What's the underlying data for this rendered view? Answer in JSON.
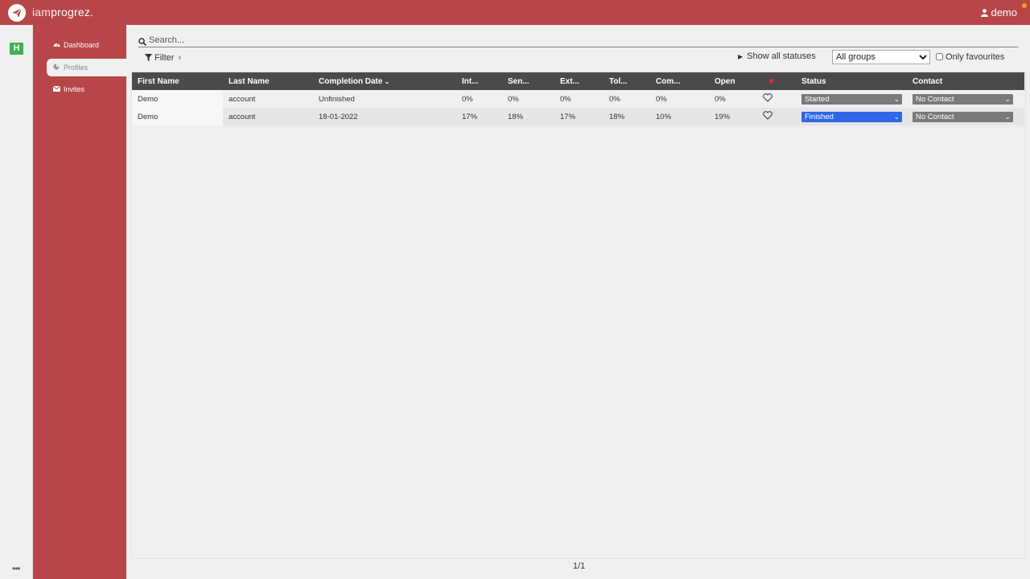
{
  "app": {
    "brand_light": "iam",
    "brand_bold": "progrez."
  },
  "user": {
    "name": "demo"
  },
  "rail": {
    "badge": "H",
    "more": "•••"
  },
  "sidebar": {
    "items": [
      {
        "label": "Dashboard",
        "icon": "dashboard-icon"
      },
      {
        "label": "Profiles",
        "icon": "pie-chart-icon"
      },
      {
        "label": "Invites",
        "icon": "envelope-icon"
      }
    ]
  },
  "search": {
    "placeholder": "Search..."
  },
  "filter": {
    "label": "Filter"
  },
  "controls": {
    "show_all_statuses": "Show all statuses",
    "groups_selected": "All groups",
    "only_favourites": "Only favourites"
  },
  "table": {
    "headers": [
      "First Name",
      "Last Name",
      "Completion Date",
      "Int...",
      "Sen...",
      "Ext...",
      "Tol...",
      "Com...",
      "Open",
      "♥",
      "Status",
      "Contact"
    ],
    "rows": [
      {
        "first": "Demo",
        "last": "account",
        "date": "Unfinished",
        "int": "0%",
        "sen": "0%",
        "ext": "0%",
        "tol": "0%",
        "com": "0%",
        "open": "0%",
        "status": "Started",
        "contact": "No Contact"
      },
      {
        "first": "Demo",
        "last": "account",
        "date": "18-01-2022",
        "int": "17%",
        "sen": "18%",
        "ext": "17%",
        "tol": "18%",
        "com": "10%",
        "open": "19%",
        "status": "Finished",
        "contact": "No Contact"
      }
    ]
  },
  "pagination": {
    "text": "1/1"
  },
  "colors": {
    "brand_red": "#b84648",
    "header_dark": "#4a4a4a",
    "status_blue": "#2f67e8",
    "status_grey": "#7a7a7a",
    "rail_green": "#3eb055"
  }
}
